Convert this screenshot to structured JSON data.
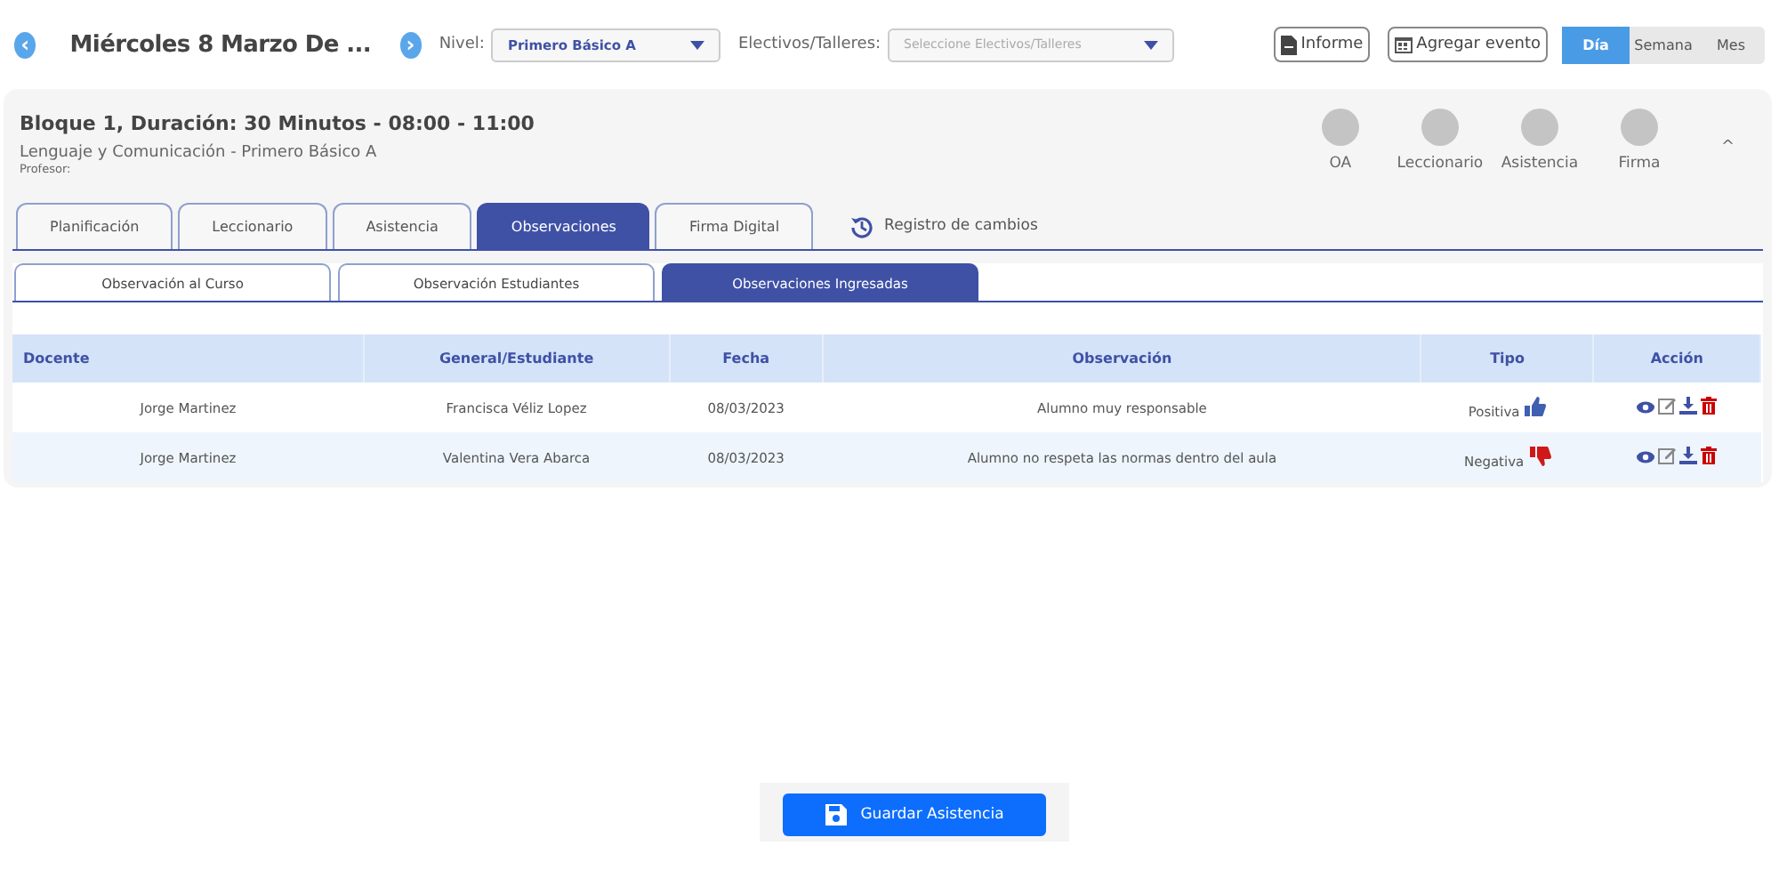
{
  "header": {
    "prev": "‹",
    "date": "Miércoles 8 Marzo De ...",
    "next": "›",
    "level_label": "Nivel:",
    "level_value": "Primero Básico A",
    "electives_label": "Electivos/Talleres:",
    "electives_placeholder": "Seleccione Electivos/Talleres",
    "report_button": "Informe",
    "event_button": "Agregar evento",
    "views": [
      {
        "label": "Día",
        "selected": true
      },
      {
        "label": "Semana",
        "selected": false
      },
      {
        "label": "Mes",
        "selected": false
      }
    ]
  },
  "block": {
    "title": "Bloque 1, Duración: 30 Minutos - 08:00 - 11:00",
    "subject": "Lenguaje y Comunicación - Primero Básico A",
    "teacher": "Profesor:",
    "steps": [
      {
        "label": "OA"
      },
      {
        "label": "Leccionario"
      },
      {
        "label": "Asistencia"
      },
      {
        "label": "Firma"
      }
    ],
    "collapse": "^"
  },
  "tabs": [
    {
      "label": "Planificación",
      "selected": false
    },
    {
      "label": "Leccionario",
      "selected": false
    },
    {
      "label": "Asistencia",
      "selected": false
    },
    {
      "label": "Observaciones",
      "selected": true
    },
    {
      "label": "Firma Digital",
      "selected": false
    }
  ],
  "history_link": "Registro de cambios",
  "subtabs": [
    {
      "label": "Observación al Curso",
      "selected": false
    },
    {
      "label": "Observación Estudiantes",
      "selected": false
    },
    {
      "label": "Observaciones Ingresadas",
      "selected": true
    }
  ],
  "table": {
    "columns": [
      "Docente",
      "General/Estudiante",
      "Fecha",
      "Observación",
      "Tipo",
      "Acción"
    ],
    "rows": [
      {
        "docente": "Jorge Martinez",
        "estudiante": "Francisca Véliz Lopez",
        "fecha": "08/03/2023",
        "observacion": "Alumno muy responsable",
        "tipo": "Positiva",
        "kind": "positive"
      },
      {
        "docente": "Jorge Martinez",
        "estudiante": "Valentina Vera Abarca",
        "fecha": "08/03/2023",
        "observacion": "Alumno no respeta las normas dentro del aula",
        "tipo": "Negativa",
        "kind": "negative"
      }
    ]
  },
  "save_button": "Guardar Asistencia"
}
